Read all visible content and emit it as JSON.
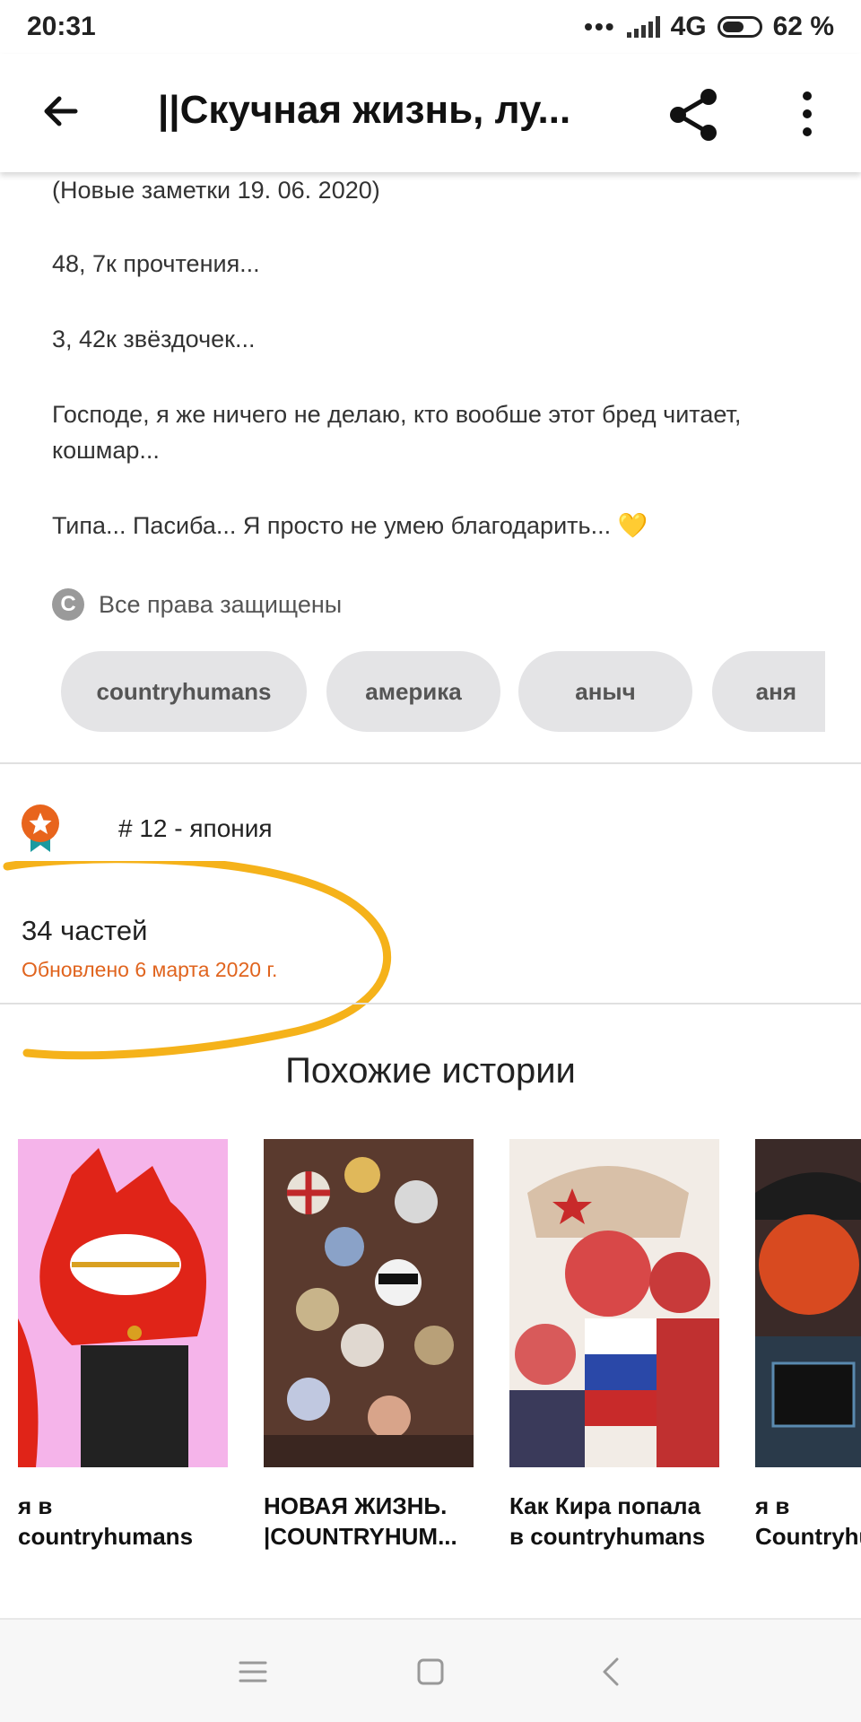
{
  "status_bar": {
    "time": "20:31",
    "network": "4G",
    "battery": "62 %",
    "battery_level": 0.62
  },
  "app_bar": {
    "title": "||Скучная жизнь, лу..."
  },
  "description": {
    "line1": "(Новые заметки 19. 06. 2020)",
    "line2": "48, 7к прочтения...",
    "line3": "3, 42к звёздочек...",
    "line4": "Господе, я же ничего не делаю, кто вообше этот бред читает, кошмар...",
    "line5": "Типа... Пасиба... Я просто не умею благодарить... 💛"
  },
  "copyright": {
    "text": "Все права защищены"
  },
  "tags": [
    "countryhumans",
    "америка",
    "аныч",
    "аня"
  ],
  "ranking": {
    "text": "# 12 - япония"
  },
  "parts": {
    "count": "34 частей",
    "updated": "Обновлено 6 марта 2020 г."
  },
  "similar": {
    "title": "Похожие истории",
    "stories": [
      {
        "title": "я в countryhumans"
      },
      {
        "title": "НОВАЯ ЖИЗНЬ. |COUNTRYHUM..."
      },
      {
        "title": "Как Кира попала в countryhumans"
      },
      {
        "title": "я в Countryhumans..."
      }
    ]
  },
  "colors": {
    "accent": "#e0641e",
    "highlight": "#f5b21a",
    "tag_bg": "#e4e4e6"
  }
}
